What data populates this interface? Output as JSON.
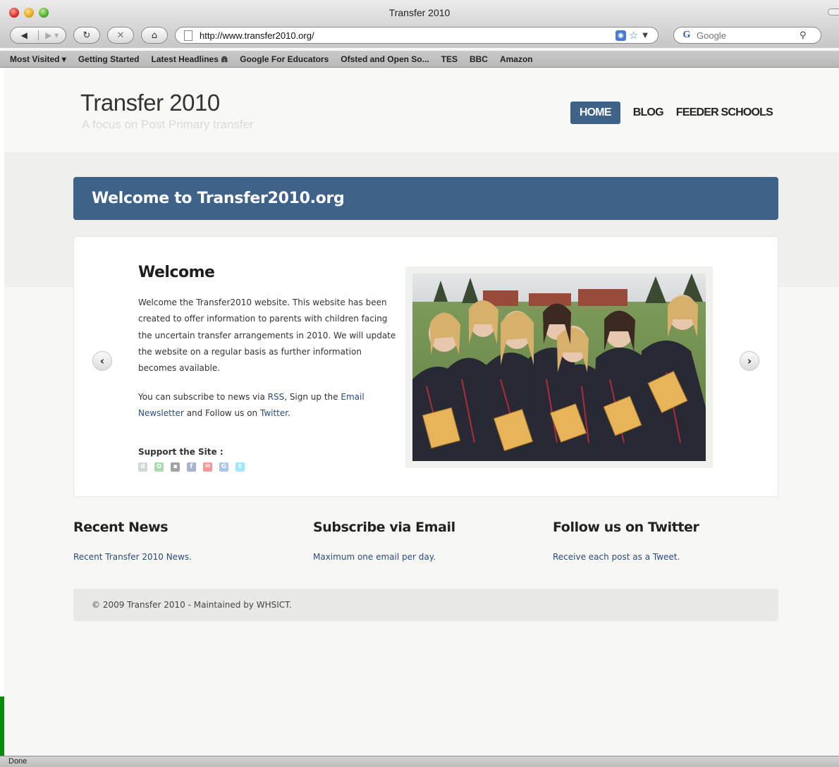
{
  "window": {
    "title": "Transfer 2010"
  },
  "toolbar": {
    "back_icon": "back-arrow-icon",
    "forward_icon": "forward-arrow-icon",
    "url": "http://www.transfer2010.org/",
    "search_placeholder": "Google",
    "search_engine_label": "G"
  },
  "bookmarks": [
    "Most Visited ▾",
    "Getting Started",
    "Latest Headlines ⋒",
    "Google For Educators",
    "Ofsted and Open So...",
    "TES",
    "BBC",
    "Amazon"
  ],
  "site": {
    "title": "Transfer 2010",
    "tagline": "A focus on Post Primary transfer",
    "nav": [
      "HOME",
      "BLOG",
      "FEEDER SCHOOLS"
    ],
    "active_nav": "HOME"
  },
  "banner": {
    "text": "Welcome to Transfer2010.org"
  },
  "slide": {
    "heading": "Welcome",
    "body": "Welcome the Transfer2010 website. This website has been created to offer information to parents with children facing the uncertain transfer arrangements in 2010. We will update the website on a regular basis as further information becomes available.",
    "subscribe_prefix": "You can subscribe to news via ",
    "rss_link": "RSS",
    "signup_text": ", Sign up the ",
    "email_link": "Email Newsletter",
    "follow_text": " and Follow us on ",
    "twitter_link": "Twitter",
    "end_period": ".",
    "support_label": "Support the Site :",
    "photo_alt": "Group of schoolgirls in uniform holding books"
  },
  "columns": [
    {
      "heading": "Recent News",
      "text": "Recent Transfer 2010 News."
    },
    {
      "heading": "Subscribe via Email",
      "text": "Maximum one email per day."
    },
    {
      "heading": "Follow us on Twitter",
      "text": "Receive each post as a Tweet."
    }
  ],
  "footer": {
    "text": "© 2009 Transfer 2010 - Maintained by WHSICT."
  },
  "status": {
    "text": "Done"
  },
  "colors": {
    "accent": "#3f6289",
    "link": "#2a4b7c"
  }
}
